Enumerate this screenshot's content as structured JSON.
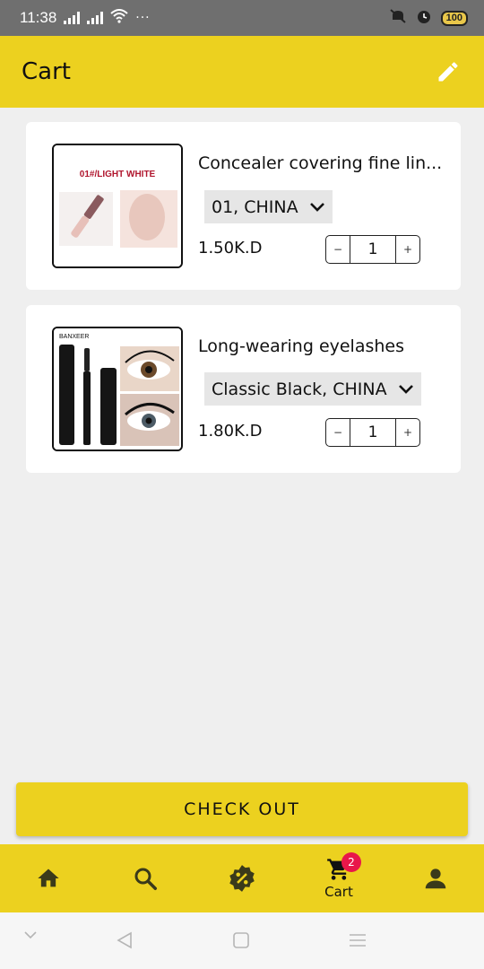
{
  "status_bar": {
    "time": "11:38",
    "battery": "100"
  },
  "header": {
    "title": "Cart",
    "edit_icon": "pencil-icon"
  },
  "cart": {
    "items": [
      {
        "title": "Concealer covering fine lin...",
        "variant": "01, CHINA",
        "price": "1.50K.D",
        "quantity": "1",
        "image_label": "01#/LIGHT WHITE"
      },
      {
        "title": "Long-wearing eyelashes",
        "variant": "Classic Black, CHINA",
        "price": "1.80K.D",
        "quantity": "1",
        "image_label": "BANXEER"
      }
    ]
  },
  "checkout": {
    "label": "CHECK OUT"
  },
  "bottom_nav": {
    "items": [
      {
        "icon": "home-icon",
        "label": ""
      },
      {
        "icon": "search-icon",
        "label": ""
      },
      {
        "icon": "discount-icon",
        "label": ""
      },
      {
        "icon": "cart-icon",
        "label": "Cart",
        "badge": "2",
        "active": true
      },
      {
        "icon": "profile-icon",
        "label": ""
      }
    ]
  },
  "colors": {
    "accent": "#ecd11f",
    "badge": "#e8174a",
    "background": "#efefef",
    "status_bar": "#6f6f6f"
  }
}
